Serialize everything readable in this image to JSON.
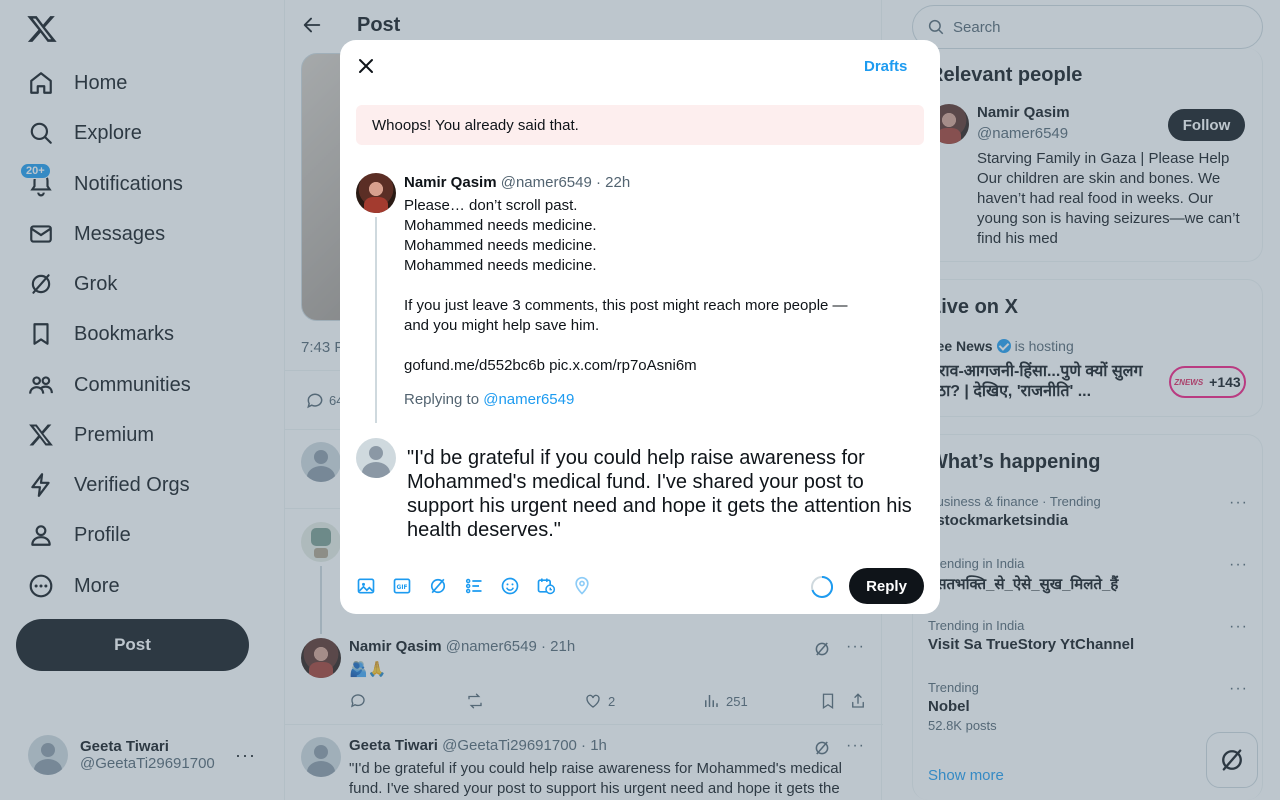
{
  "nav": {
    "items": [
      {
        "label": "Home"
      },
      {
        "label": "Explore"
      },
      {
        "label": "Notifications",
        "badge": "20+"
      },
      {
        "label": "Messages"
      },
      {
        "label": "Grok"
      },
      {
        "label": "Bookmarks"
      },
      {
        "label": "Communities"
      },
      {
        "label": "Premium"
      },
      {
        "label": "Verified Orgs"
      },
      {
        "label": "Profile"
      },
      {
        "label": "More"
      }
    ],
    "post_button": "Post"
  },
  "account": {
    "name": "Geeta Tiwari",
    "handle": "@GeetaTi29691700",
    "more": "···"
  },
  "center": {
    "title": "Post",
    "post_time": "7:43 P",
    "reply_count": "64",
    "thread_reply": {
      "name": "Namir Qasim",
      "meta": "@namer6549 · 21h",
      "body": "🫂🙏",
      "likes": "2",
      "views": "251"
    },
    "own_reply": {
      "name": "Geeta Tiwari",
      "meta": "@GeetaTi29691700 · 1h",
      "body": "\"I'd be grateful if you could help raise awareness for Mohammed's medical fund. I've shared your post to support his urgent need and hope it gets the"
    }
  },
  "right": {
    "search_placeholder": "Search",
    "relevant": {
      "heading": "Relevant people",
      "name": "Namir Qasim",
      "handle": "@namer6549",
      "follow": "Follow",
      "bio": "Starving Family in Gaza | Please Help Our children are skin and bones. We haven’t had real food in weeks. Our young son is having seizures—we can’t find his med"
    },
    "live": {
      "heading": "Live on X",
      "host": "Zee News",
      "hosting": "is hosting",
      "title": "शराव-आगजनी-हिंसा...पुणे क्यों सुलग उठा? | देखिए, 'राजनीति' ...",
      "pill_logo": "ZNEWS",
      "pill_count": "+143"
    },
    "happening": {
      "heading": "What’s happening",
      "trends": [
        {
          "context": "Business & finance · Trending",
          "title": "#stockmarketsindia",
          "posts": ""
        },
        {
          "context": "Trending in India",
          "title": "#सतभक्ति_से_ऐसे_सुख_मिलते_हैं",
          "posts": ""
        },
        {
          "context": "Trending in India",
          "title": "Visit Sa TrueStory YtChannel",
          "posts": ""
        },
        {
          "context": "Trending",
          "title": "Nobel",
          "posts": "52.8K posts"
        }
      ],
      "show_more": "Show more"
    }
  },
  "modal": {
    "drafts": "Drafts",
    "error": "Whoops! You already said that.",
    "original": {
      "name": "Namir Qasim",
      "meta": "@namer6549 · 22h",
      "lines": [
        "Please… don’t scroll past.",
        "Mohammed needs medicine.",
        "Mohammed needs medicine.",
        "Mohammed needs medicine.",
        "",
        "If you just leave 3 comments, this post might reach more people — and you might help save him.",
        "",
        "gofund.me/d552bc6b pic.x.com/rp7oAsni6m"
      ],
      "replying_prefix": "Replying to",
      "replying_handle": "@namer6549"
    },
    "reply_text": "\"I'd be grateful if you could help raise awareness for Mohammed's medical fund. I've shared your post to support his urgent need and hope it gets the attention his health deserves.\"",
    "reply_button": "Reply",
    "colors": {
      "accent": "#1d9bf0",
      "error_bg": "#fdeeee",
      "button": "#0f1419",
      "live": "#f91880"
    }
  }
}
